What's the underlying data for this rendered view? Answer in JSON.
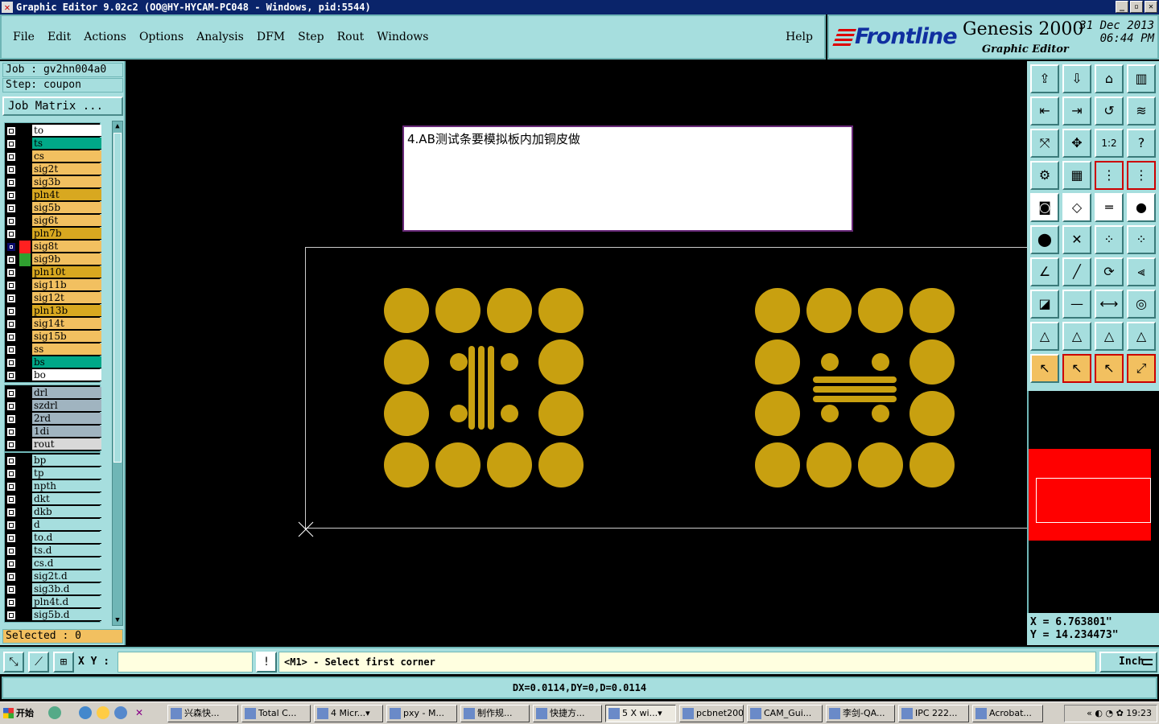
{
  "window": {
    "title": "Graphic Editor 9.02c2  (OO@HY-HYCAM-PC048 - Windows, pid:5544)"
  },
  "menu": {
    "items": [
      "File",
      "Edit",
      "Actions",
      "Options",
      "Analysis",
      "DFM",
      "Step",
      "Rout",
      "Windows"
    ],
    "help": "Help"
  },
  "brand": {
    "logo": "Frontline",
    "product": "Genesis 2000",
    "subtitle": "Graphic Editor",
    "date": "31 Dec 2013",
    "time": "06:44 PM"
  },
  "job": {
    "job_label": "Job : gv2hn004a0",
    "step_label": "Step: coupon",
    "matrix_button": "Job Matrix ..."
  },
  "layers": {
    "board": [
      {
        "name": "to",
        "color": "#ffffff"
      },
      {
        "name": "ts",
        "color": "#00a888"
      },
      {
        "name": "cs",
        "color": "#f2c060"
      },
      {
        "name": "sig2t",
        "color": "#f2c060"
      },
      {
        "name": "sig3b",
        "color": "#f2c060"
      },
      {
        "name": "pln4t",
        "color": "#d8a820"
      },
      {
        "name": "sig5b",
        "color": "#f2c060"
      },
      {
        "name": "sig6t",
        "color": "#f2c060"
      },
      {
        "name": "pln7b",
        "color": "#d8a820"
      },
      {
        "name": "sig8t",
        "color": "#f2c060",
        "selected": true,
        "swatch": "#ff2020"
      },
      {
        "name": "sig9b",
        "color": "#f2c060",
        "swatch": "#30a030"
      },
      {
        "name": "pln10t",
        "color": "#d8a820"
      },
      {
        "name": "sig11b",
        "color": "#f2c060"
      },
      {
        "name": "sig12t",
        "color": "#f2c060"
      },
      {
        "name": "pln13b",
        "color": "#d8a820"
      },
      {
        "name": "sig14t",
        "color": "#f2c060"
      },
      {
        "name": "sig15b",
        "color": "#f2c060"
      },
      {
        "name": "ss",
        "color": "#f2c060"
      },
      {
        "name": "bs",
        "color": "#00a888"
      },
      {
        "name": "bo",
        "color": "#ffffff"
      }
    ],
    "drill": [
      {
        "name": "drl",
        "color": "#a0b4c0"
      },
      {
        "name": "szdrl",
        "color": "#a0b4c0"
      },
      {
        "name": "2rd",
        "color": "#a0b4c0"
      },
      {
        "name": "1di",
        "color": "#a0b4c0"
      },
      {
        "name": "rout",
        "color": "#d8d8d8"
      }
    ],
    "misc": [
      {
        "name": "bp",
        "color": "#a6dede"
      },
      {
        "name": "tp",
        "color": "#a6dede"
      },
      {
        "name": "npth",
        "color": "#a6dede"
      },
      {
        "name": "dkt",
        "color": "#a6dede"
      },
      {
        "name": "dkb",
        "color": "#a6dede"
      },
      {
        "name": "d",
        "color": "#a6dede"
      },
      {
        "name": "to.d",
        "color": "#a6dede"
      },
      {
        "name": "ts.d",
        "color": "#a6dede"
      },
      {
        "name": "cs.d",
        "color": "#a6dede"
      },
      {
        "name": "sig2t.d",
        "color": "#a6dede"
      },
      {
        "name": "sig3b.d",
        "color": "#a6dede"
      },
      {
        "name": "pln4t.d",
        "color": "#a6dede"
      },
      {
        "name": "sig5b.d",
        "color": "#a6dede"
      }
    ],
    "selected_label": "Selected : 0"
  },
  "canvas": {
    "note": "4.AB测试条要模拟板内加铜皮做",
    "pad_color": "#c8a010"
  },
  "coords": {
    "x": "X  =  6.763801\"",
    "y": "Y  =  14.234473\""
  },
  "command": {
    "xy_label": "X Y :",
    "xy_value": "",
    "prompt": "<M1> - Select first corner",
    "units": "Inch"
  },
  "measure": "DX=0.0114,DY=0,D=0.0114",
  "taskbar": {
    "start": "开始",
    "tasks": [
      {
        "label": "兴森快..."
      },
      {
        "label": "Total C..."
      },
      {
        "label": "4 Micr...▾"
      },
      {
        "label": "pxy - M..."
      },
      {
        "label": "制作规..."
      },
      {
        "label": "快捷方..."
      },
      {
        "label": "5 X wi...▾",
        "active": true
      },
      {
        "label": "pcbnet2002"
      },
      {
        "label": "CAM_Gui..."
      },
      {
        "label": "李剑-QA..."
      },
      {
        "label": "IPC 222..."
      },
      {
        "label": "Acrobat..."
      }
    ],
    "clock": "19:23"
  }
}
